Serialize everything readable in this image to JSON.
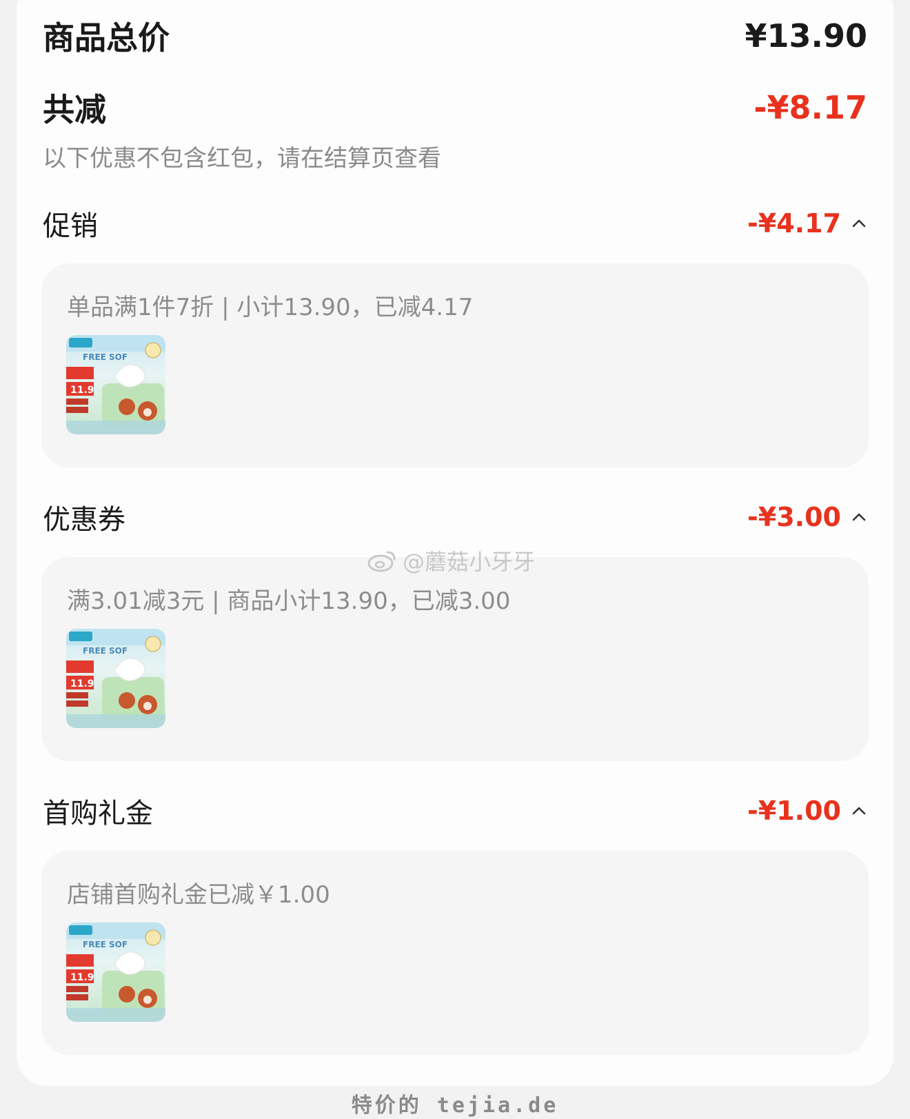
{
  "summary": {
    "total_label": "商品总价",
    "total_value": "¥13.90",
    "discount_label": "共减",
    "discount_value": "-¥8.17",
    "note": "以下优惠不包含红包，请在结算页查看"
  },
  "sections": [
    {
      "title": "促销",
      "amount": "-¥4.17",
      "detail": "单品满1件7折 | 小计13.90，已减4.17",
      "product_badge": "11.9"
    },
    {
      "title": "优惠券",
      "amount": "-¥3.00",
      "detail": "满3.01减3元 | 商品小计13.90，已减3.00",
      "product_badge": "11.9"
    },
    {
      "title": "首购礼金",
      "amount": "-¥1.00",
      "detail": "店铺首购礼金已减￥1.00",
      "product_badge": "11.9"
    }
  ],
  "watermark": "@蘑菇小牙牙",
  "footer": "特价的 tejia.de",
  "colors": {
    "accent_red": "#e8321e",
    "text_dark": "#1a1a1a",
    "text_gray": "#8c8c8c",
    "panel_bg": "#f5f5f5"
  },
  "icons": {
    "expand": "chevron-up-icon",
    "watermark_logo": "weibo-icon"
  }
}
